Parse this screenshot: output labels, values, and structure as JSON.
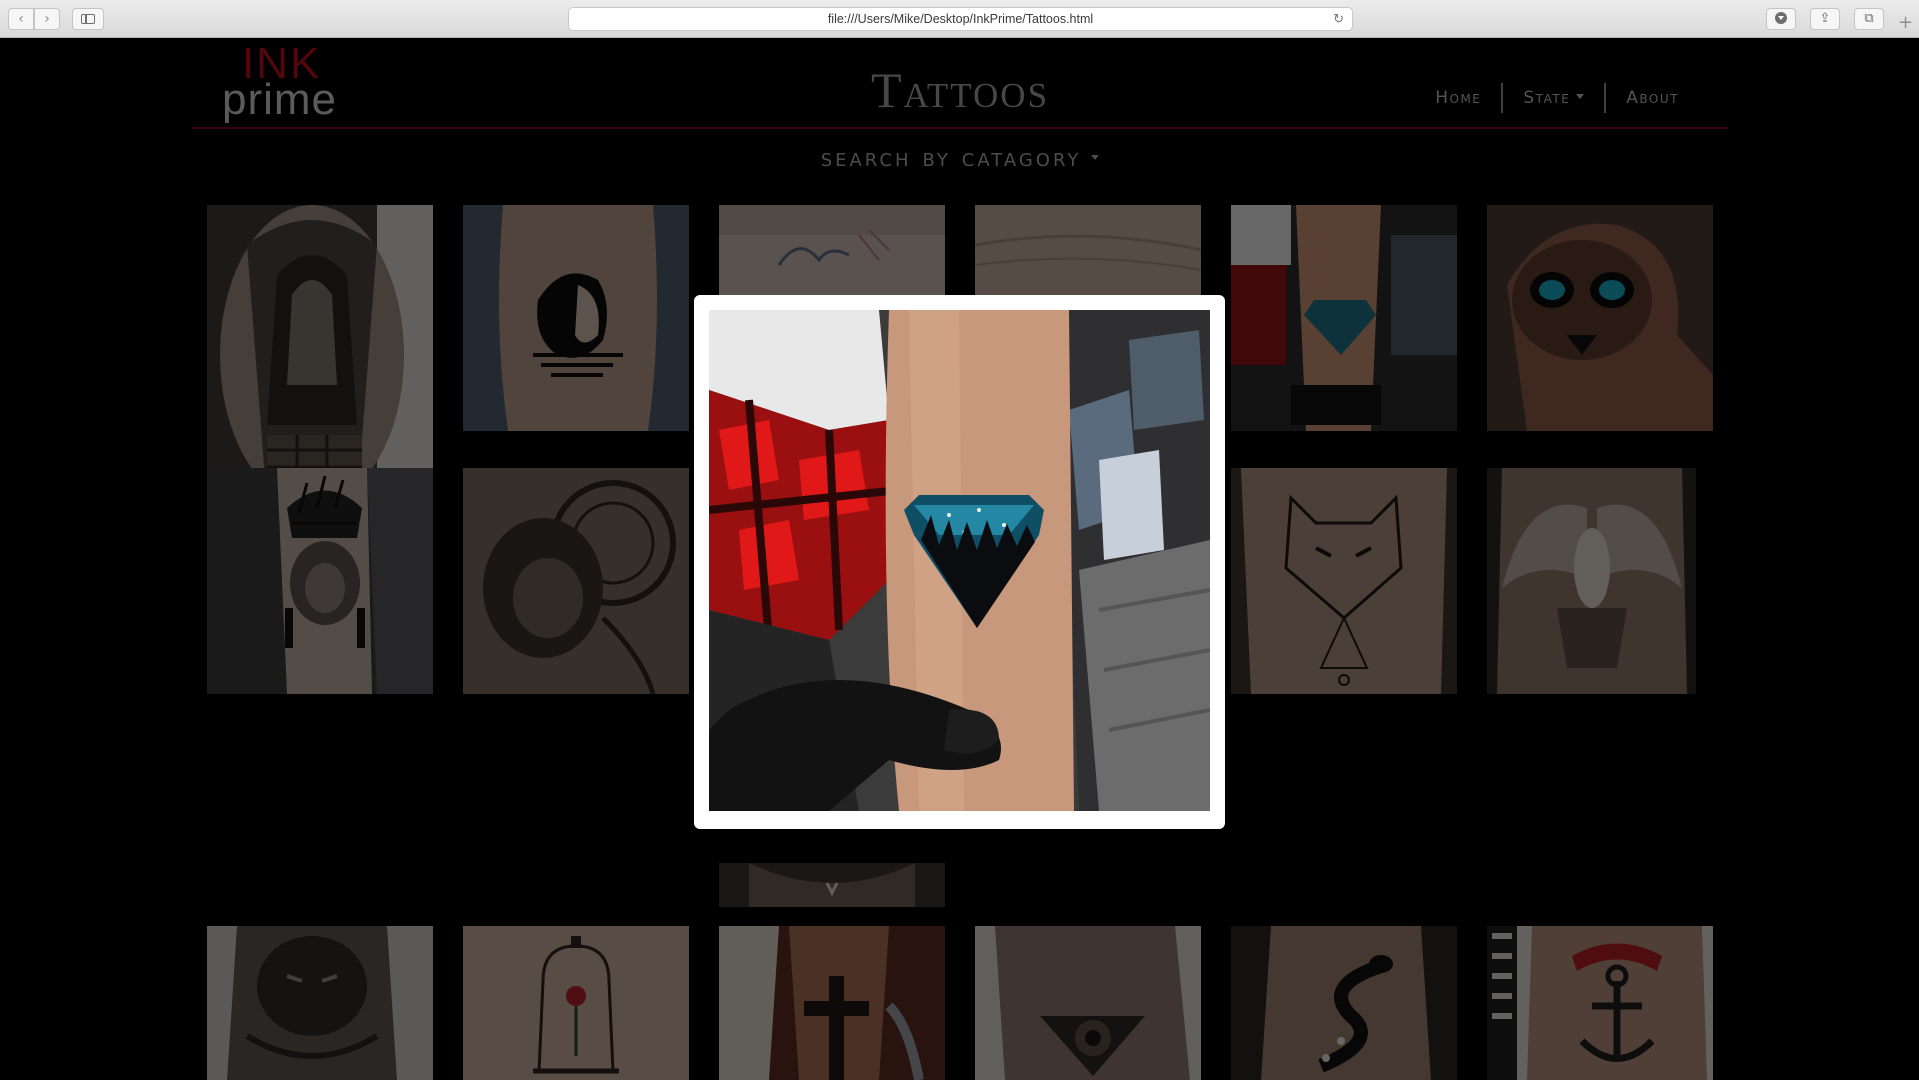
{
  "browser": {
    "url": "file:///Users/Mike/Desktop/InkPrime/Tattoos.html",
    "back_glyph": "‹",
    "forward_glyph": "›",
    "reload_glyph": "↻",
    "new_tab_glyph": "+",
    "tabs_glyph": "⧉",
    "share_glyph": "⇪"
  },
  "site": {
    "logo_top": "INK",
    "logo_bottom": "prime",
    "title": "Tattoos",
    "nav": {
      "home": "Home",
      "state": "State",
      "about": "About"
    },
    "search_category": "search by catagory",
    "accent_color": "#b3111a"
  },
  "gallery": {
    "tiles": [
      {
        "subject": "gargoyle arm tattoo"
      },
      {
        "subject": "woman face back tattoo"
      },
      {
        "subject": "wrist line art tattoo"
      },
      {
        "subject": "wrist tattoo"
      },
      {
        "subject": "diamond forest wrist tattoo"
      },
      {
        "subject": "skull hand tattoo"
      },
      {
        "subject": "lion headdress tattoo"
      },
      {
        "subject": "mandala lion tattoo"
      },
      {
        "subject": "geometric wolf tattoo"
      },
      {
        "subject": "angel wings back tattoo"
      },
      {
        "subject": "lion sleeve tattoo"
      },
      {
        "subject": "rose bell jar tattoo"
      },
      {
        "subject": "cross forearm tattoo"
      },
      {
        "subject": "sunflower triangle tattoo"
      },
      {
        "subject": "snake arm tattoo"
      },
      {
        "subject": "traditional anchor tattoo"
      }
    ]
  },
  "modal": {
    "subject": "diamond forest wrist tattoo enlarged"
  }
}
